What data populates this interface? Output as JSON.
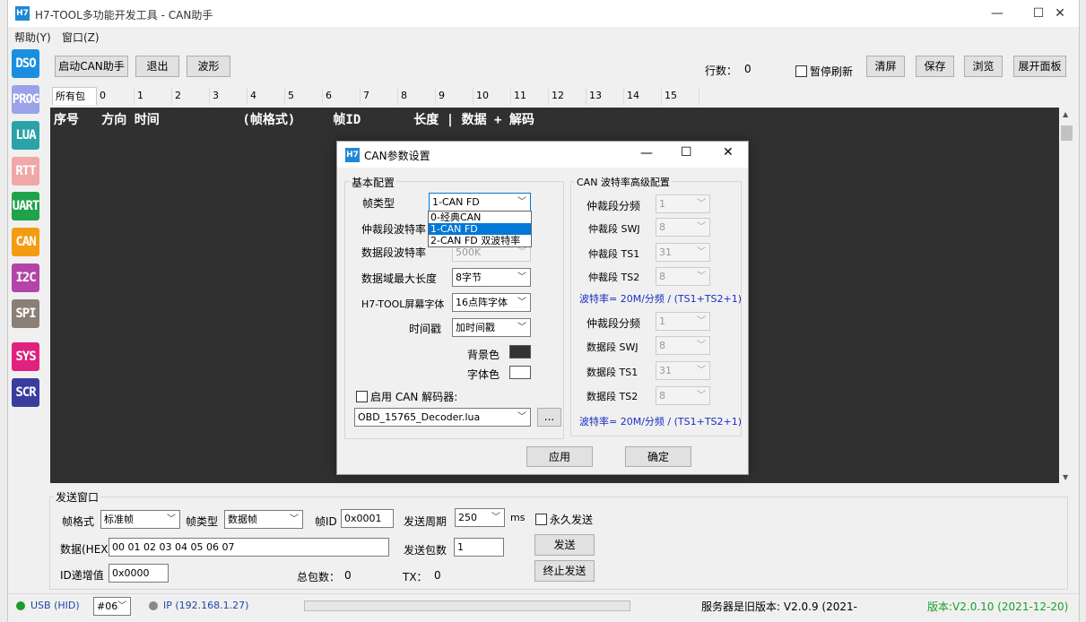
{
  "window": {
    "logo": "H7",
    "title": "H7-TOOL多功能开发工具 - CAN助手",
    "controls": [
      "—",
      "☐",
      "✕"
    ]
  },
  "menu": [
    "帮助(Y)",
    "窗口(Z)"
  ],
  "sidebar": {
    "items": [
      {
        "label": "DSO",
        "color": "#1a8fe0"
      },
      {
        "label": "PROG",
        "color": "#9aa2e8"
      },
      {
        "label": "LUA",
        "color": "#2ba2a8"
      },
      {
        "label": "RTT",
        "color": "#f0a7a7"
      },
      {
        "label": "UART",
        "color": "#1fa34a"
      },
      {
        "label": "CAN",
        "color": "#f39c12"
      },
      {
        "label": "I2C",
        "color": "#b344a8"
      },
      {
        "label": "SPI",
        "color": "#8a7f76"
      },
      {
        "label": "SYS",
        "color": "#e0227e"
      },
      {
        "label": "SCR",
        "color": "#3a3d9e"
      }
    ]
  },
  "toolbar": {
    "start_label": "启动CAN助手",
    "exit_label": "退出",
    "wave_label": "波形",
    "rows_label": "行数：",
    "rows_value": "0",
    "pause_label": "暂停刷新",
    "clear_label": "清屏",
    "save_label": "保存",
    "browse_label": "浏览",
    "expand_label": "展开面板"
  },
  "tabs": [
    "所有包",
    "0",
    "1",
    "2",
    "3",
    "4",
    "5",
    "6",
    "7",
    "8",
    "9",
    "10",
    "11",
    "12",
    "13",
    "14",
    "15"
  ],
  "console": {
    "header": "序号   方向 时间           (帧格式)     帧ID       长度 | 数据 + 解码"
  },
  "send": {
    "group_label": "发送窗口",
    "frame_format_label": "帧格式",
    "frame_format_value": "标准帧",
    "frame_type_label": "帧类型",
    "frame_type_value": "数据帧",
    "frame_id_label": "帧ID",
    "frame_id_value": "0x0001",
    "period_label": "发送周期",
    "period_value": "250",
    "period_unit": "ms",
    "forever_label": "永久发送",
    "data_label": "数据(HEX)",
    "data_value": "00 01 02 03 04 05 06 07",
    "count_label": "发送包数",
    "count_value": "1",
    "send_button": "发送",
    "stop_button": "终止发送",
    "id_inc_label": "ID递增值",
    "id_inc_value": "0x0000",
    "total_label": "总包数：",
    "total_value": "0",
    "tx_label": "TX：",
    "tx_value": "0"
  },
  "status": {
    "usb": "USB (HID)",
    "device": "#06",
    "ip": "IP (192.168.1.27)",
    "server": "服务器是旧版本: V2.0.9 (2021-",
    "version": "版本:V2.0.10 (2021-12-20)",
    "usb_color": "#1a9e2a",
    "ip_color": "#888888"
  },
  "dialog": {
    "logo": "H7",
    "title": "CAN参数设置",
    "basic_group": "基本配置",
    "frame_type_label": "帧类型",
    "frame_type_value": "1-CAN FD",
    "frame_type_options": [
      "0-经典CAN",
      "1-CAN FD",
      "2-CAN FD 双波特率"
    ],
    "arb_baud_label": "仲裁段波特率",
    "data_baud_label": "数据段波特率",
    "data_baud_value": "500K",
    "max_len_label": "数据域最大长度",
    "max_len_value": "8字节",
    "font_label": "H7-TOOL屏幕字体",
    "font_value": "16点阵字体",
    "timestamp_label": "时间戳",
    "timestamp_value": "加时间戳",
    "bg_color_label": "背景色",
    "fg_color_label": "字体色",
    "bg_color": "#333333",
    "fg_color": "#ffffff",
    "decoder_enable_label": "启用 CAN 解码器:",
    "decoder_value": "OBD_15765_Decoder.lua",
    "browse_label": "...",
    "adv_group": "CAN 波特率高级配置",
    "arb_div_label": "仲裁段分频",
    "arb_div_value": "1",
    "arb_sjw_label": "仲裁段 SWJ",
    "arb_sjw_value": "8",
    "arb_ts1_label": "仲裁段 TS1",
    "arb_ts1_value": "31",
    "arb_ts2_label": "仲裁段 TS2",
    "arb_ts2_value": "8",
    "formula_arb": "波特率= 20M/分频 / (TS1+TS2+1)",
    "data_div_label": "仲裁段分频",
    "data_div_value": "1",
    "data_sjw_label": "数据段 SWJ",
    "data_sjw_value": "8",
    "data_ts1_label": "数据段 TS1",
    "data_ts1_value": "31",
    "data_ts2_label": "数据段 TS2",
    "data_ts2_value": "8",
    "formula_data": "波特率= 20M/分频 / (TS1+TS2+1)",
    "apply_label": "应用",
    "ok_label": "确定"
  }
}
